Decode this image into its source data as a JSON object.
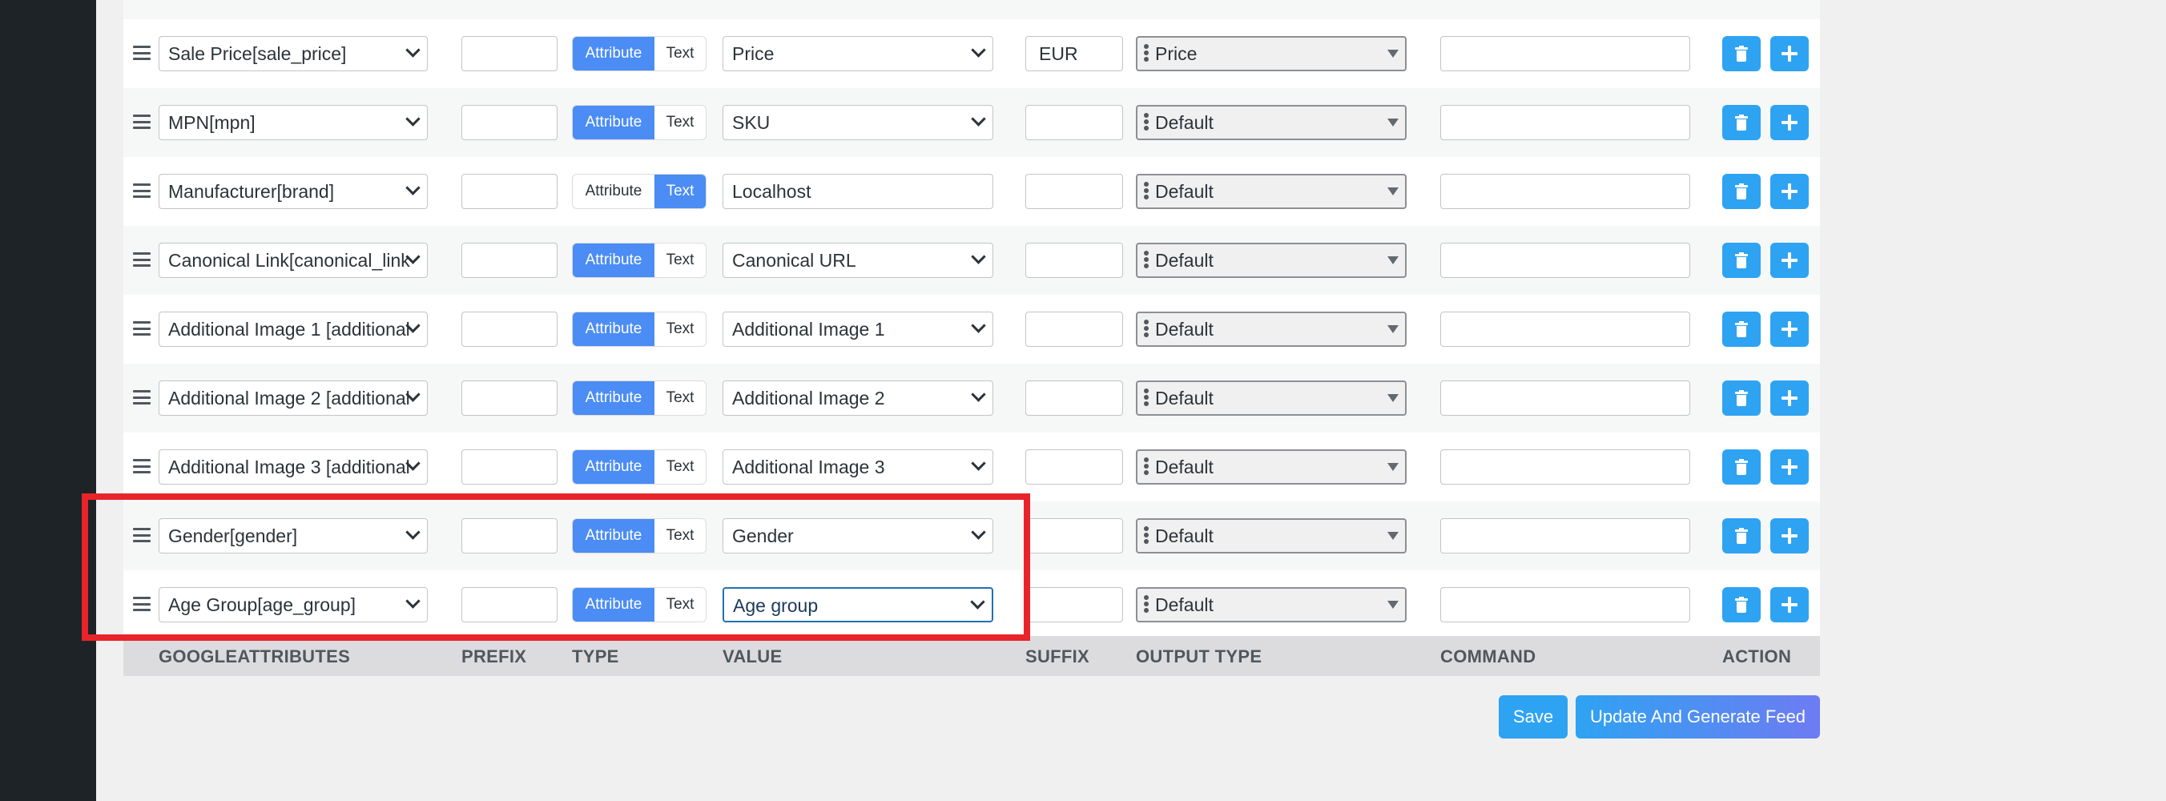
{
  "rows": [
    {
      "attribute": "Sale Price[sale_price]",
      "prefix": "",
      "type_active": "Attribute",
      "value": "Price",
      "value_kind": "select",
      "suffix": "EUR",
      "output_type": "Price",
      "command": ""
    },
    {
      "attribute": "MPN[mpn]",
      "prefix": "",
      "type_active": "Attribute",
      "value": "SKU",
      "value_kind": "select",
      "suffix": "",
      "output_type": "Default",
      "command": ""
    },
    {
      "attribute": "Manufacturer[brand]",
      "prefix": "",
      "type_active": "Text",
      "value": "Localhost",
      "value_kind": "text",
      "suffix": "",
      "output_type": "Default",
      "command": ""
    },
    {
      "attribute": "Canonical Link[canonical_link",
      "prefix": "",
      "type_active": "Attribute",
      "value": "Canonical URL",
      "value_kind": "select",
      "suffix": "",
      "output_type": "Default",
      "command": ""
    },
    {
      "attribute": "Additional Image 1 [additional",
      "prefix": "",
      "type_active": "Attribute",
      "value": "Additional Image 1",
      "value_kind": "select",
      "suffix": "",
      "output_type": "Default",
      "command": ""
    },
    {
      "attribute": "Additional Image 2 [additional",
      "prefix": "",
      "type_active": "Attribute",
      "value": "Additional Image 2",
      "value_kind": "select",
      "suffix": "",
      "output_type": "Default",
      "command": ""
    },
    {
      "attribute": "Additional Image 3 [additional",
      "prefix": "",
      "type_active": "Attribute",
      "value": "Additional Image 3",
      "value_kind": "select",
      "suffix": "",
      "output_type": "Default",
      "command": ""
    },
    {
      "attribute": "Gender[gender]",
      "prefix": "",
      "type_active": "Attribute",
      "value": "Gender",
      "value_kind": "select",
      "suffix": "",
      "output_type": "Default",
      "command": ""
    },
    {
      "attribute": "Age Group[age_group]",
      "prefix": "",
      "type_active": "Attribute",
      "value": "Age group",
      "value_kind": "select",
      "suffix": "",
      "output_type": "Default",
      "command": "",
      "focused": true
    }
  ],
  "type_labels": {
    "attribute": "Attribute",
    "text": "Text"
  },
  "columns": {
    "googleattributes": "GOOGLEATTRIBUTES",
    "prefix": "PREFIX",
    "type": "TYPE",
    "value": "VALUE",
    "suffix": "SUFFIX",
    "output_type": "OUTPUT TYPE",
    "command": "COMMAND",
    "action": "ACTION"
  },
  "buttons": {
    "save": "Save",
    "update": "Update And Generate Feed"
  },
  "icons": {
    "delete": "trash-icon",
    "add": "plus-icon",
    "drag": "drag-handle-icon",
    "dropdown": "chevron-down-icon"
  },
  "colors": {
    "primary": "#2ea3f2",
    "toggle_active": "#4b8cf5",
    "highlight": "#e8242a",
    "sidebar": "#1d2327"
  }
}
